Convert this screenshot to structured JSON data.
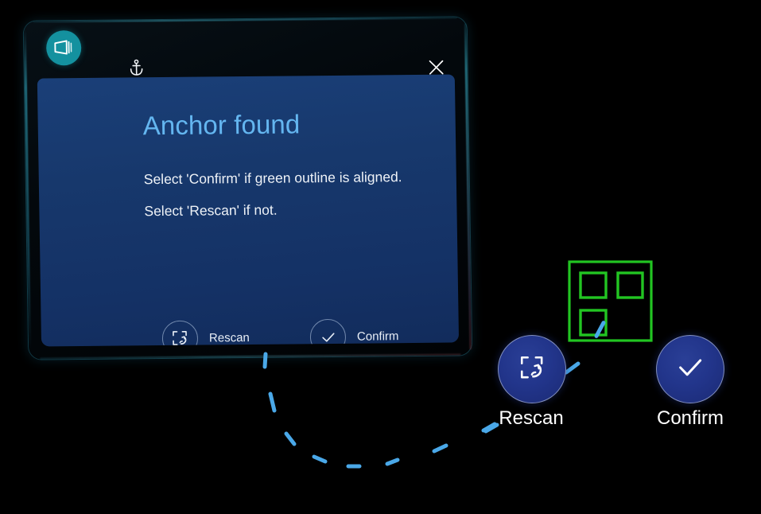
{
  "app": {
    "badge_icon": "panel-3d-icon",
    "anchor_icon": "anchor-icon",
    "close_icon": "close-x-icon"
  },
  "dialog": {
    "title": "Anchor found",
    "line_1": "Select 'Confirm' if green outline is aligned.",
    "line_2": "Select 'Rescan' if not.",
    "title_color": "#64b6f0",
    "panel_color": "#17386c",
    "actions": [
      {
        "id": "rescan",
        "label": "Rescan",
        "icon": "rescan-frame-icon"
      },
      {
        "id": "confirm",
        "label": "Confirm",
        "icon": "checkmark-icon"
      }
    ]
  },
  "scene": {
    "marker": {
      "name": "anchor-marker-outline",
      "color": "#22c522",
      "finder_squares": 3
    },
    "tether": {
      "name": "dashed-tether-line",
      "color": "#4aa8e8",
      "dash_count": 11
    }
  },
  "buttons": [
    {
      "id": "rescan",
      "label": "Rescan",
      "icon": "rescan-frame-icon",
      "color": "#22358b"
    },
    {
      "id": "confirm",
      "label": "Confirm",
      "icon": "checkmark-icon",
      "color": "#22358b"
    }
  ]
}
